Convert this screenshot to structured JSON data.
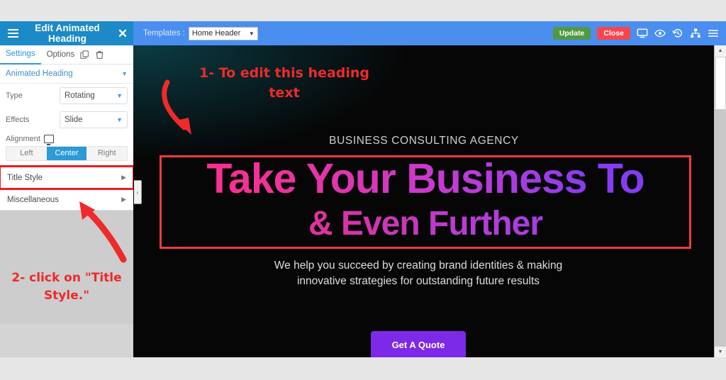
{
  "panel": {
    "title": "Edit Animated Heading",
    "menu_icon": "hamburger-icon",
    "close_icon": "close-icon",
    "tabs": [
      {
        "label": "Settings",
        "active": true
      },
      {
        "label": "Options",
        "active": false
      }
    ],
    "tab_icons": [
      "duplicate-icon",
      "trash-icon"
    ],
    "widget_select": "Animated Heading",
    "fields": [
      {
        "label": "Type",
        "value": "Rotating"
      },
      {
        "label": "Effects",
        "value": "Slide"
      }
    ],
    "alignment": {
      "label": "Alignment",
      "device_icon": "monitor-icon",
      "options": [
        "Left",
        "Center",
        "Right"
      ],
      "selected": "Center"
    },
    "sections": [
      {
        "label": "Title Style",
        "highlighted": true
      },
      {
        "label": "Miscellaneous",
        "highlighted": false
      }
    ],
    "collapse_handle": "‹"
  },
  "toolbar": {
    "templates_label": "Templates :",
    "template_value": "Home Header",
    "update_label": "Update",
    "close_label": "Close",
    "icons": [
      "responsive-mode-icon",
      "preview-eye-icon",
      "history-icon",
      "navigator-icon",
      "menu-icon"
    ]
  },
  "canvas": {
    "eyebrow": "BUSINESS CONSULTING AGENCY",
    "heading_line1": "Take Your Business To",
    "heading_line2": "& Even Further",
    "subtext_line1": "We help you succeed by creating brand identities & making",
    "subtext_line2": "innovative strategies for outstanding future results",
    "cta_label": "Get A Quote"
  },
  "annotations": {
    "step1_line1": "1- To edit this heading",
    "step1_line2": "text",
    "step2_line1": "2- click on \"Title",
    "step2_line2": "Style.\""
  },
  "colors": {
    "panel_header": "#1b8ac6",
    "toolbar": "#4a8ef0",
    "accent_blue": "#2b9ad6",
    "update_green": "#4f9a42",
    "close_red": "#f9454c",
    "annotation_red": "#ef2a2a",
    "highlight_red": "#ec1c24",
    "cta_purple": "#7c2ae8",
    "heading_gradient_from": "#ff2e8a",
    "heading_gradient_to": "#7b3cf6"
  }
}
